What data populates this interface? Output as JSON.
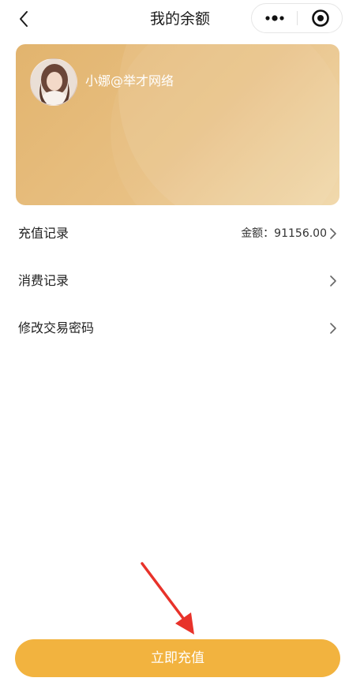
{
  "header": {
    "title": "我的余额",
    "back_icon": "chevron-left-icon",
    "more_icon": "more-dots-icon",
    "target_icon": "target-icon"
  },
  "card": {
    "username": "小娜@举才网络",
    "avatar_icon": "avatar",
    "gradient_start": "#e2b46e",
    "gradient_end": "#f0d6a6"
  },
  "menu": {
    "items": [
      {
        "label": "充值记录",
        "value": "金额：91156.00"
      },
      {
        "label": "消费记录",
        "value": ""
      },
      {
        "label": "修改交易密码",
        "value": ""
      }
    ]
  },
  "footer": {
    "recharge_label": "立即充值",
    "accent": "#f2b33f"
  },
  "annotation": {
    "arrow_color": "#e8322a"
  }
}
